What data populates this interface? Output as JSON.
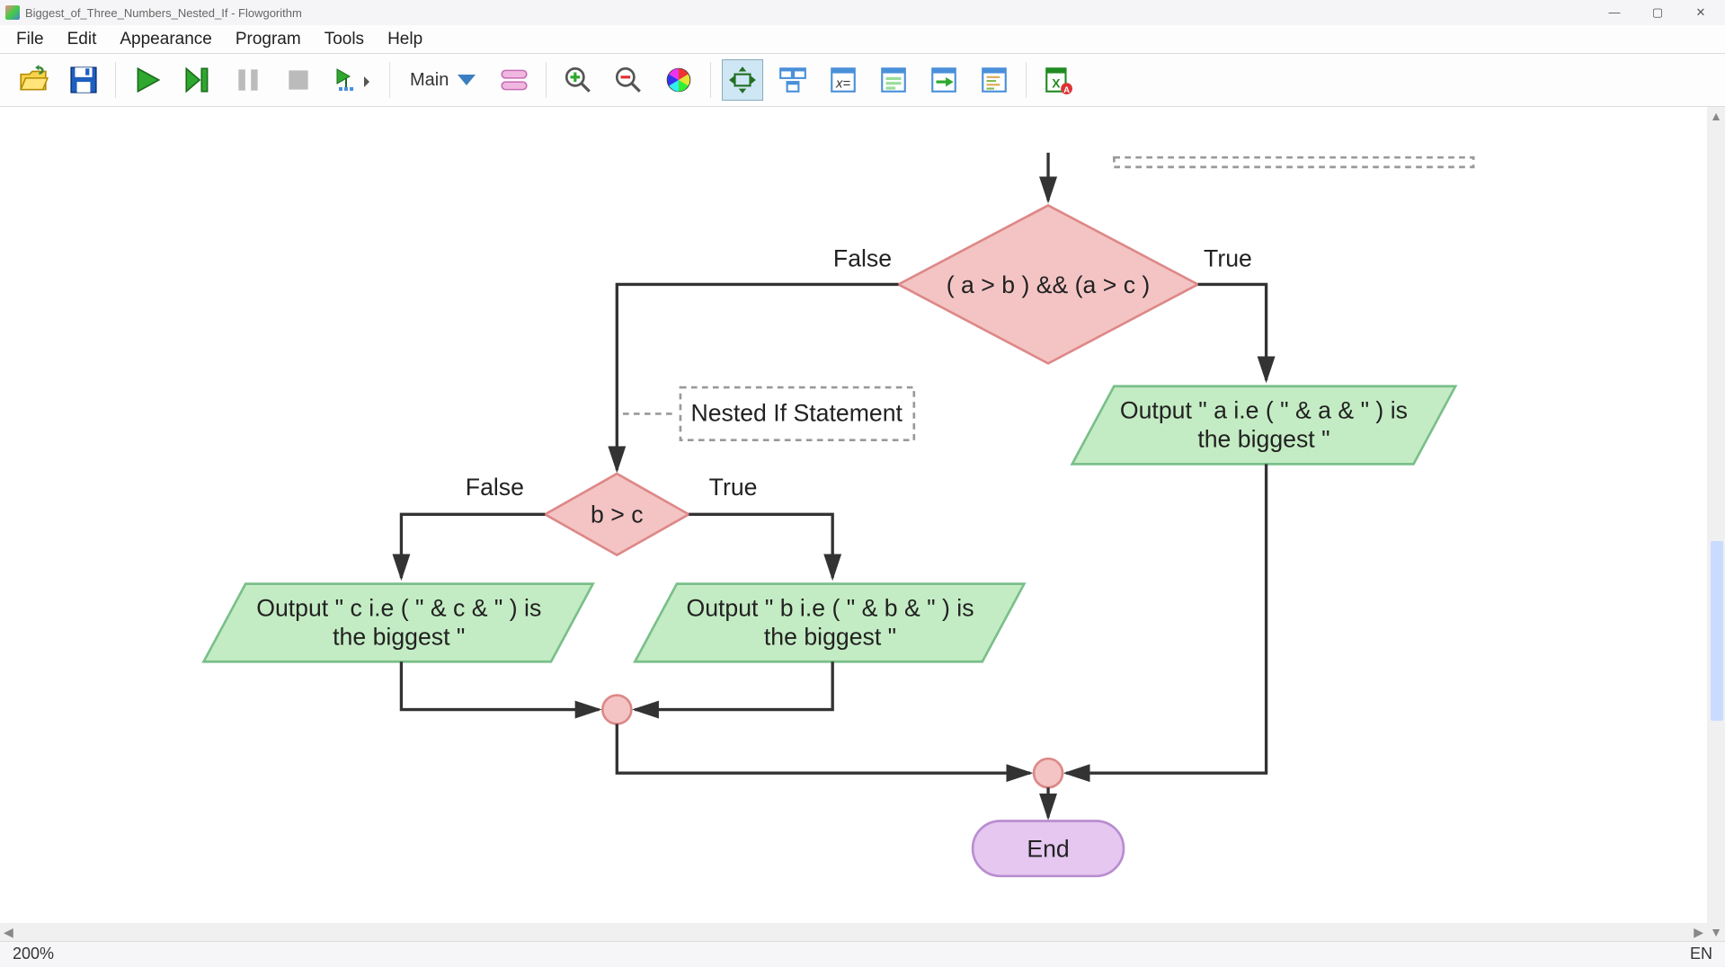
{
  "window": {
    "title": "Biggest_of_Three_Numbers_Nested_If - Flowgorithm"
  },
  "menu": {
    "file": "File",
    "edit": "Edit",
    "appearance": "Appearance",
    "program": "Program",
    "tools": "Tools",
    "help": "Help"
  },
  "toolbar": {
    "function_selected": "Main"
  },
  "flow": {
    "decision1": "( a > b ) && (a > c )",
    "dec1_false": "False",
    "dec1_true": "True",
    "comment": "Nested If Statement",
    "decision2": "b > c",
    "dec2_false": "False",
    "dec2_true": "True",
    "out_a_line1": "Output \" a i.e ( \" & a & \" ) is",
    "out_a_line2": "the biggest \"",
    "out_b_line1": "Output \" b i.e ( \" & b & \" ) is",
    "out_b_line2": "the biggest \"",
    "out_c_line1": "Output \" c i.e ( \" & c & \" ) is",
    "out_c_line2": "the biggest \"",
    "end": "End"
  },
  "status": {
    "zoom": "200%",
    "lang": "EN"
  },
  "chart_data": {
    "type": "flowchart",
    "nodes": [
      {
        "id": "d1",
        "shape": "decision",
        "text": "( a > b ) && (a > c )"
      },
      {
        "id": "outA",
        "shape": "output",
        "text": "Output \" a i.e ( \" & a & \" ) is the biggest \""
      },
      {
        "id": "cmt",
        "shape": "comment",
        "text": "Nested If Statement"
      },
      {
        "id": "d2",
        "shape": "decision",
        "text": "b > c"
      },
      {
        "id": "outB",
        "shape": "output",
        "text": "Output \" b i.e ( \" & b & \" ) is the biggest \""
      },
      {
        "id": "outC",
        "shape": "output",
        "text": "Output \" c i.e ( \" & c & \" ) is the biggest \""
      },
      {
        "id": "join2",
        "shape": "connector"
      },
      {
        "id": "join1",
        "shape": "connector"
      },
      {
        "id": "end",
        "shape": "terminator",
        "text": "End"
      }
    ],
    "edges": [
      {
        "from": "d1",
        "to": "outA",
        "label": "True"
      },
      {
        "from": "d1",
        "to": "d2",
        "label": "False"
      },
      {
        "from": "d2",
        "to": "outB",
        "label": "True"
      },
      {
        "from": "d2",
        "to": "outC",
        "label": "False"
      },
      {
        "from": "outB",
        "to": "join2"
      },
      {
        "from": "outC",
        "to": "join2"
      },
      {
        "from": "join2",
        "to": "join1"
      },
      {
        "from": "outA",
        "to": "join1"
      },
      {
        "from": "join1",
        "to": "end"
      }
    ]
  }
}
